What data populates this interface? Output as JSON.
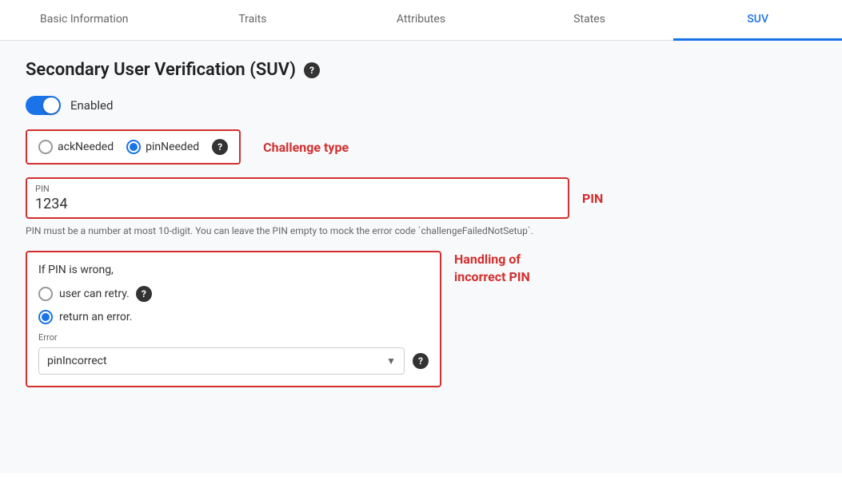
{
  "tabs": [
    {
      "id": "basic-information",
      "label": "Basic Information",
      "active": false
    },
    {
      "id": "traits",
      "label": "Traits",
      "active": false
    },
    {
      "id": "attributes",
      "label": "Attributes",
      "active": false
    },
    {
      "id": "states",
      "label": "States",
      "active": false
    },
    {
      "id": "suv",
      "label": "SUV",
      "active": true
    }
  ],
  "title": "Secondary User Verification (SUV)",
  "toggle": {
    "enabled": true,
    "label": "Enabled"
  },
  "challenge_type": {
    "label": "Challenge type",
    "options": [
      {
        "id": "ack-needed",
        "label": "ackNeeded",
        "selected": false
      },
      {
        "id": "pin-needed",
        "label": "pinNeeded",
        "selected": true
      }
    ]
  },
  "pin": {
    "label": "PIN",
    "field_label": "PIN",
    "value": "1234",
    "hint": "PIN must be a number at most 10-digit. You can leave the PIN empty to mock the error\ncode `challengeFailedNotSetup`."
  },
  "incorrect_pin": {
    "section_label": "Handling of\nincorrect PIN",
    "title": "If PIN is wrong,",
    "options": [
      {
        "id": "retry",
        "label": "user can retry.",
        "selected": false,
        "has_help": true
      },
      {
        "id": "error",
        "label": "return an error.",
        "selected": true,
        "has_help": false
      }
    ],
    "error_field": {
      "label": "Error",
      "value": "pinIncorrect"
    }
  }
}
